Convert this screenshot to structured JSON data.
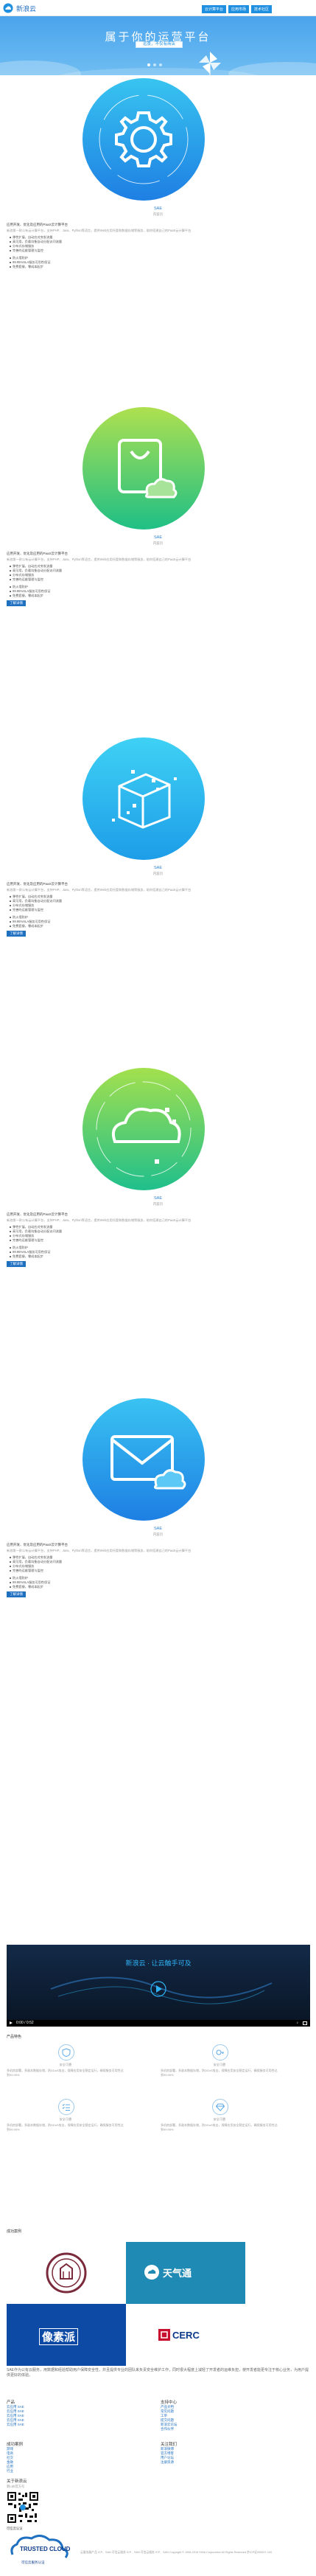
{
  "header": {
    "logo_text": "新浪云",
    "nav": [
      "云计算平台",
      "应用市场",
      "技术社区"
    ]
  },
  "hero": {
    "title": "属于你的运营平台",
    "tagline": "远景，不仅有商店"
  },
  "products": [
    {
      "name": "SAE",
      "sub": "内容页",
      "desc_title": "应用开发、优化及应用的PaaS云计算平台",
      "desc": "新浪第一款公有云计算平台，支持PHP、Java、Python等语言，提供Web应用托管和数据存储等服务，助你搭建自己的PaaS云计算平台",
      "features": [
        "弹性扩展，自动应对突发流量",
        "高可用，负载均衡自动分配访问流量",
        "分布式存储服务",
        "完善的运维管理与监控",
        "防火墙防护",
        "99.95%SLA服务可用性保证",
        "免费套餐，零成本起步"
      ],
      "button": null,
      "icon": "gear-icon",
      "gradient": [
        "#38c4f0",
        "#1e7fe3"
      ]
    },
    {
      "name": "SAE",
      "sub": "内容页",
      "desc_title": "应用开发、优化及应用的PaaS云计算平台",
      "desc": "新浪第一款公有云计算平台，支持PHP、Java、Python等语言，提供Web应用托管和数据存储等服务，助你搭建自己的PaaS云计算平台",
      "features": [
        "弹性扩展，自动应对突发流量",
        "高可用，负载均衡自动分配访问流量",
        "分布式存储服务",
        "完善的运维管理与监控",
        "防火墙防护",
        "99.95%SLA服务可用性保证",
        "免费套餐，零成本起步"
      ],
      "button": "了解详情",
      "icon": "shopping-bag-cloud-icon",
      "gradient": [
        "#aee04f",
        "#1fbf86"
      ]
    },
    {
      "name": "SAE",
      "sub": "内容页",
      "desc_title": "应用开发、优化及应用的PaaS云计算平台",
      "desc": "新浪第一款公有云计算平台，支持PHP、Java、Python等语言，提供Web应用托管和数据存储等服务，助你搭建自己的PaaS云计算平台",
      "features": [
        "弹性扩展，自动应对突发流量",
        "高可用，负载均衡自动分配访问流量",
        "分布式存储服务",
        "完善的运维管理与监控",
        "防火墙防护",
        "99.95%SLA服务可用性保证",
        "免费套餐，零成本起步"
      ],
      "button": "了解详情",
      "icon": "cube-icon",
      "gradient": [
        "#3fd1f4",
        "#1d9de8"
      ]
    },
    {
      "name": "SAE",
      "sub": "内容页",
      "desc_title": "应用开发、优化及应用的PaaS云计算平台",
      "desc": "新浪第一款公有云计算平台，支持PHP、Java、Python等语言，提供Web应用托管和数据存储等服务，助你搭建自己的PaaS云计算平台",
      "features": [
        "弹性扩展，自动应对突发流量",
        "高可用，负载均衡自动分配访问流量",
        "分布式存储服务",
        "完善的运维管理与监控",
        "防火墙防护",
        "99.95%SLA服务可用性保证",
        "免费套餐，零成本起步"
      ],
      "button": "了解详情",
      "icon": "cloud-icon",
      "gradient": [
        "#a3e04e",
        "#1fbf8c"
      ]
    },
    {
      "name": "SAE",
      "sub": "内容页",
      "desc_title": "应用开发、优化及应用的PaaS云计算平台",
      "desc": "新浪第一款公有云计算平台，支持PHP、Java、Python等语言，提供Web应用托管和数据存储等服务，助你搭建自己的PaaS云计算平台",
      "features": [
        "弹性扩展，自动应对突发流量",
        "高可用，负载均衡自动分配访问流量",
        "分布式存储服务",
        "完善的运维管理与监控",
        "防火墙防护",
        "99.95%SLA服务可用性保证",
        "免费套餐，零成本起步"
      ],
      "button": "了解详情",
      "icon": "mail-cloud-icon",
      "gradient": [
        "#39c3f2",
        "#1e7fe3"
      ]
    }
  ],
  "video": {
    "title": "新浪云 · 让云触手可及",
    "time": "0:00 / 0:52"
  },
  "features_section": {
    "title": "产品特色",
    "items": [
      {
        "name": "安全可靠",
        "desc": "多机房部署，多副本数据存储，防DDoS攻击，保障应用安全稳定运行，确保服务可用性达到99.95%",
        "icon": "shield-icon"
      },
      {
        "name": "安全可靠",
        "desc": "多机房部署，多副本数据存储，防DDoS攻击，保障应用安全稳定运行，确保服务可用性达到99.95%",
        "icon": "key-icon"
      },
      {
        "name": "安全可靠",
        "desc": "多机房部署，多副本数据存储，防DDoS攻击，保障应用安全稳定运行，确保服务可用性达到99.95%",
        "icon": "checklist-icon"
      },
      {
        "name": "安全可靠",
        "desc": "多机房部署，多副本数据存储，防DDoS攻击，保障应用安全稳定运行，确保服务可用性达到99.95%",
        "icon": "diamond-icon"
      }
    ]
  },
  "cases": {
    "title": "成功案例",
    "items": [
      {
        "name": "清华大学",
        "icon": "university-seal-icon"
      },
      {
        "name": "天气通",
        "icon": "weather-logo-icon"
      },
      {
        "name": "像素派",
        "icon": "pixel-logo-icon"
      },
      {
        "name": "CERC",
        "icon": "cerc-logo-icon"
      }
    ]
  },
  "about": {
    "text": "SAE作为公有云服务，用数据和经验帮助用户保障安全性，并且提供专业的团队来负责安全维护工作，同时很大程度上减轻了开发者的运维负担，使开发者能更专注于核心业务，为用户提供更好的体验。"
  },
  "footer": {
    "columns": [
      {
        "title": "产品",
        "links": [
          "云应用 SAE",
          "云应用 SAE",
          "云应用 SAE",
          "云应用 SAE",
          "云应用 SAE"
        ]
      },
      {
        "title": "支持中心",
        "links": [
          "产品文档",
          "常见问题",
          "工单",
          "提交问题",
          "新浪云论坛",
          "合作伙伴"
        ]
      },
      {
        "title": "成功案例",
        "links": [
          "游戏",
          "电商",
          "社交",
          "金融",
          "应用",
          "行业"
        ]
      },
      {
        "title": "关注我们",
        "links": [
          "新浪微博",
          "官方博客",
          "用户论坛",
          "注册资源"
        ]
      }
    ],
    "about_title": "关于新浪云",
    "about_sub": "新LMI官方号",
    "cert_title": "可信云认证",
    "trust_logo_text": "TRUSTED CLOUD",
    "trust_logo_sub": "可信云服务认证",
    "copyright": "云服务器产品 ICP、SAN 可信云服务 ICP、SAN 可信云服务 ICP、SAN   Copyright © 1996-2015 SINA Corporation All Rights Reserved 京ICP证000007-100"
  }
}
